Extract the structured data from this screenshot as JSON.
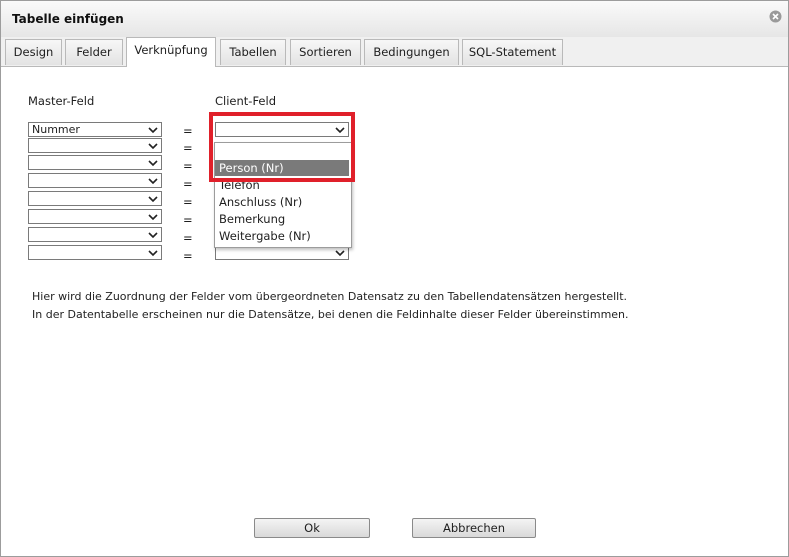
{
  "dialog": {
    "title": "Tabelle einfügen"
  },
  "tabs": [
    {
      "label": "Design"
    },
    {
      "label": "Felder"
    },
    {
      "label": "Verknüpfung"
    },
    {
      "label": "Tabellen"
    },
    {
      "label": "Sortieren"
    },
    {
      "label": "Bedingungen"
    },
    {
      "label": "SQL-Statement"
    }
  ],
  "columns": {
    "master": "Master-Feld",
    "client": "Client-Feld"
  },
  "rows": [
    {
      "master": "Nummer",
      "eq": "=",
      "client": ""
    },
    {
      "master": "",
      "eq": "=",
      "client": ""
    },
    {
      "master": "",
      "eq": "=",
      "client": ""
    },
    {
      "master": "",
      "eq": "=",
      "client": ""
    },
    {
      "master": "",
      "eq": "=",
      "client": ""
    },
    {
      "master": "",
      "eq": "=",
      "client": ""
    },
    {
      "master": "",
      "eq": "=",
      "client": ""
    },
    {
      "master": "",
      "eq": "=",
      "client": ""
    }
  ],
  "dropdown": {
    "options": [
      "",
      "Person (Nr)",
      "Telefon",
      "Anschluss (Nr)",
      "Bemerkung",
      "Weitergabe (Nr)"
    ],
    "highlighted": "Person (Nr)"
  },
  "info": [
    "Hier wird die Zuordnung der Felder vom übergeordneten Datensatz zu den Tabellendatensätzen hergestellt.",
    "In der Datentabelle erscheinen nur die Datensätze, bei denen die Feldinhalte dieser Felder übereinstimmen."
  ],
  "buttons": {
    "ok": "Ok",
    "cancel": "Abbrechen"
  },
  "colors": {
    "highlight_border": "#e0202a",
    "selected_option": "#7a7a7a"
  }
}
